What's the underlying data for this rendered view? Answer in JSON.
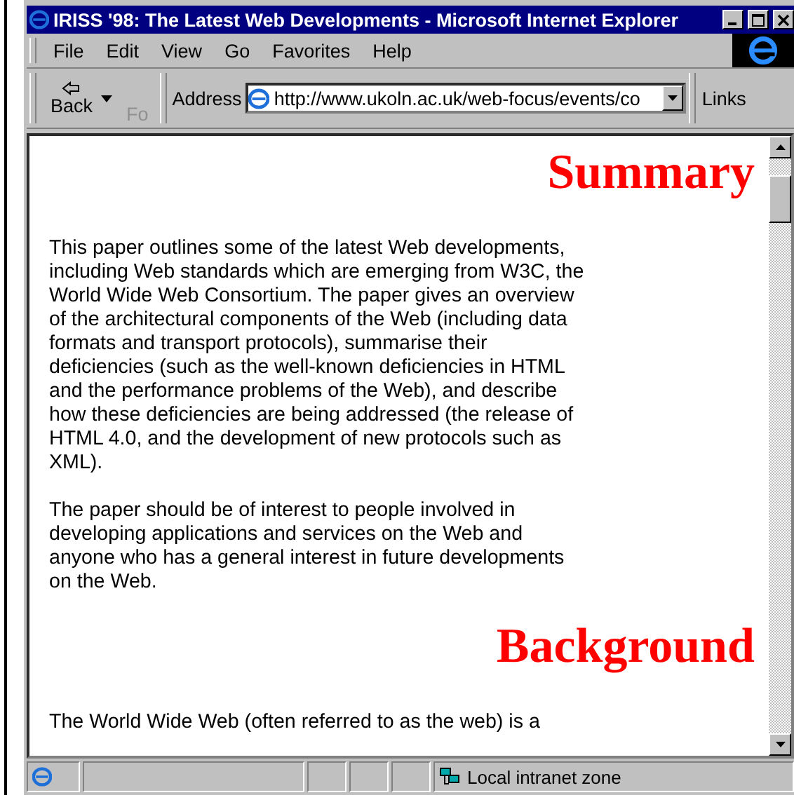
{
  "window": {
    "title": "IRISS '98: The Latest Web Developments - Microsoft Internet Explorer"
  },
  "menu": [
    {
      "label": "File"
    },
    {
      "label": "Edit"
    },
    {
      "label": "View"
    },
    {
      "label": "Go"
    },
    {
      "label": "Favorites"
    },
    {
      "label": "Help"
    }
  ],
  "toolbar": {
    "back": {
      "label": "Back",
      "disabled": false
    },
    "forward": {
      "label": "Fo",
      "disabled": true
    },
    "address_label": "Address",
    "address": "http://www.ukoln.ac.uk/web-focus/events/co",
    "links": "Links"
  },
  "content": [
    {
      "kind": "heading",
      "text": "Summary"
    },
    {
      "kind": "paragraph",
      "text": "This paper outlines some of the latest Web developments, including Web standards which are emerging from W3C, the World Wide Web Consortium. The paper gives an overview of the architectural components of the Web (including data formats and transport protocols), summarise their deficiencies (such as the well-known deficiencies in HTML and the performance problems of the Web), and describe how these deficiencies are being addressed (the release of HTML 4.0, and the development of new protocols such as XML)."
    },
    {
      "kind": "paragraph",
      "text": "The paper should be of interest to people involved in developing applications and services on the Web and anyone who has a general interest in future developments on the Web."
    },
    {
      "kind": "heading",
      "text": "Background"
    },
    {
      "kind": "paragraph",
      "text": "The World Wide Web (often referred to as the web) is a"
    }
  ],
  "status_bar": {
    "zone": "Local intranet zone"
  }
}
